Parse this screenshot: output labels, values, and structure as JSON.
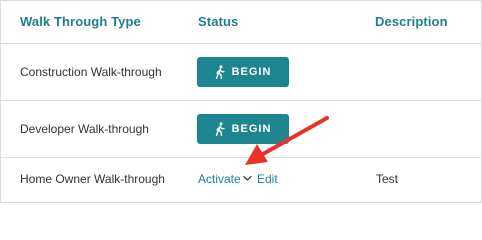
{
  "table": {
    "headers": {
      "type": "Walk Through Type",
      "status": "Status",
      "description": "Description"
    },
    "rows": [
      {
        "type": "Construction Walk-through",
        "action": "BEGIN",
        "description": ""
      },
      {
        "type": "Developer Walk-through",
        "action": "BEGIN",
        "description": ""
      },
      {
        "type": "Home Owner Walk-through",
        "activate_label": "Activate",
        "edit_label": "Edit",
        "description": "Test"
      }
    ]
  },
  "icons": {
    "begin": "walking-person-icon",
    "dropdown": "chevron-down-icon"
  },
  "colors": {
    "accent": "#1c8590",
    "header_text": "#1f7f8c",
    "annotation_arrow": "#e8332a"
  }
}
